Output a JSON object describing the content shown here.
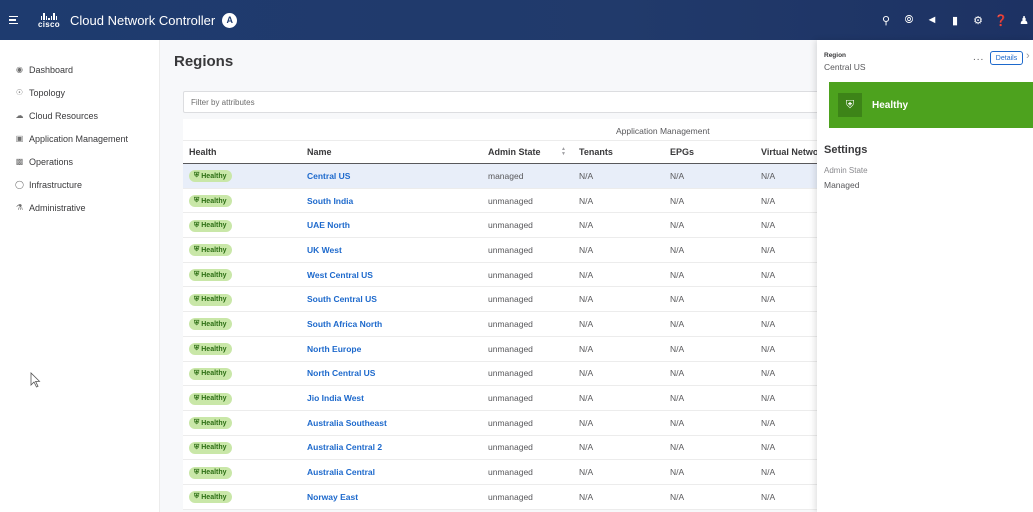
{
  "header": {
    "logo_text": "cisco",
    "title": "Cloud Network Controller",
    "badge": "A",
    "icons": [
      "search-icon",
      "compass-icon",
      "megaphone-icon",
      "bookmark-icon",
      "gear-icon",
      "help-icon",
      "user-icon"
    ]
  },
  "sidebar": {
    "items": [
      {
        "label": "Dashboard",
        "icon": "dashboard-icon"
      },
      {
        "label": "Topology",
        "icon": "globe-icon"
      },
      {
        "label": "Cloud Resources",
        "icon": "cloud-icon"
      },
      {
        "label": "Application Management",
        "icon": "window-icon"
      },
      {
        "label": "Operations",
        "icon": "operations-icon"
      },
      {
        "label": "Infrastructure",
        "icon": "infrastructure-icon"
      },
      {
        "label": "Administrative",
        "icon": "admin-icon"
      }
    ]
  },
  "main": {
    "title": "Regions",
    "filter_placeholder": "Filter by attributes",
    "group_header": "Application Management",
    "columns": [
      "Health",
      "Name",
      "Admin State",
      "Tenants",
      "EPGs",
      "Virtual Networks"
    ],
    "health_label": "Healthy",
    "rows": [
      {
        "name": "Central US",
        "admin_state": "managed",
        "tenants": "N/A",
        "epgs": "N/A",
        "vnets": "N/A"
      },
      {
        "name": "South India",
        "admin_state": "unmanaged",
        "tenants": "N/A",
        "epgs": "N/A",
        "vnets": "N/A"
      },
      {
        "name": "UAE North",
        "admin_state": "unmanaged",
        "tenants": "N/A",
        "epgs": "N/A",
        "vnets": "N/A"
      },
      {
        "name": "UK West",
        "admin_state": "unmanaged",
        "tenants": "N/A",
        "epgs": "N/A",
        "vnets": "N/A"
      },
      {
        "name": "West Central US",
        "admin_state": "unmanaged",
        "tenants": "N/A",
        "epgs": "N/A",
        "vnets": "N/A"
      },
      {
        "name": "South Central US",
        "admin_state": "unmanaged",
        "tenants": "N/A",
        "epgs": "N/A",
        "vnets": "N/A"
      },
      {
        "name": "South Africa North",
        "admin_state": "unmanaged",
        "tenants": "N/A",
        "epgs": "N/A",
        "vnets": "N/A"
      },
      {
        "name": "North Europe",
        "admin_state": "unmanaged",
        "tenants": "N/A",
        "epgs": "N/A",
        "vnets": "N/A"
      },
      {
        "name": "North Central US",
        "admin_state": "unmanaged",
        "tenants": "N/A",
        "epgs": "N/A",
        "vnets": "N/A"
      },
      {
        "name": "Jio India West",
        "admin_state": "unmanaged",
        "tenants": "N/A",
        "epgs": "N/A",
        "vnets": "N/A"
      },
      {
        "name": "Australia Southeast",
        "admin_state": "unmanaged",
        "tenants": "N/A",
        "epgs": "N/A",
        "vnets": "N/A"
      },
      {
        "name": "Australia Central 2",
        "admin_state": "unmanaged",
        "tenants": "N/A",
        "epgs": "N/A",
        "vnets": "N/A"
      },
      {
        "name": "Australia Central",
        "admin_state": "unmanaged",
        "tenants": "N/A",
        "epgs": "N/A",
        "vnets": "N/A"
      },
      {
        "name": "Norway East",
        "admin_state": "unmanaged",
        "tenants": "N/A",
        "epgs": "N/A",
        "vnets": "N/A"
      }
    ]
  },
  "panel": {
    "kind": "Region",
    "name": "Central US",
    "more": "...",
    "details_label": "Details",
    "health": "Healthy",
    "settings_title": "Settings",
    "admin_state_label": "Admin State",
    "admin_state_value": "Managed"
  },
  "colors": {
    "header_bg": "#1e3b6f",
    "link": "#1d69cc",
    "healthy": "#4da21e",
    "pill_bg": "#c9e7a8",
    "selected_row": "#e8eef9"
  }
}
